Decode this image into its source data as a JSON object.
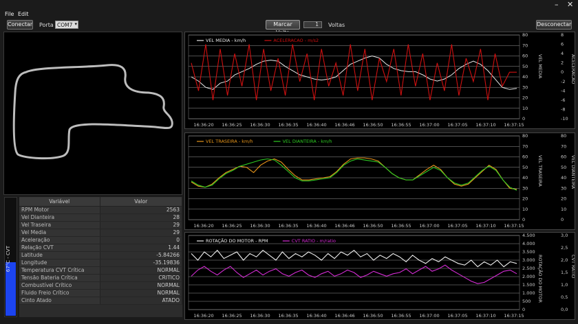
{
  "window": {
    "minimize_icon": "minimize-icon",
    "close_icon": "close-icon"
  },
  "menu": {
    "file": "File",
    "edit": "Edit"
  },
  "toolbar": {
    "connect_label": "Conectar",
    "port_label": "Porta",
    "port_value": "COM7",
    "lap_button_label": "Marcar Volta",
    "lap_count": "1",
    "laps_label": "Voltas",
    "disconnect_label": "Desconectar"
  },
  "table": {
    "headers": [
      "Variável",
      "Valor"
    ],
    "rows": [
      {
        "name": "RPM Motor",
        "value": "2563"
      },
      {
        "name": "Vel Dianteira",
        "value": "28"
      },
      {
        "name": "Vel Traseira",
        "value": "29"
      },
      {
        "name": "Vel Media",
        "value": "29"
      },
      {
        "name": "Aceleração",
        "value": "0"
      },
      {
        "name": "Relação CVT",
        "value": "1.44"
      },
      {
        "name": "Latitude",
        "value": "-5.84266"
      },
      {
        "name": "Longitude",
        "value": "-35.19836"
      },
      {
        "name": "Temperatura CVT Crítica",
        "value": "NORMAL"
      },
      {
        "name": "Tensão Bateria Crítica",
        "value": "CRITICO"
      },
      {
        "name": "Combustível Crítico",
        "value": "NORMAL"
      },
      {
        "name": "Fluido Freio Crítico",
        "value": "NORMAL"
      },
      {
        "name": "Cinto Atado",
        "value": "ATADO"
      }
    ]
  },
  "gauge": {
    "label": "67°C - CVT",
    "level": 0.45,
    "color": "#1c44f0"
  },
  "chart_data": [
    {
      "type": "line",
      "series": [
        {
          "name": "VEL MEDIA - km/h",
          "color": "#e8e8e8",
          "axis": "left"
        },
        {
          "name": "ACELERACAO - m/s2",
          "color": "#d01010",
          "axis": "right"
        }
      ],
      "x_ticks": [
        "16:36:20",
        "16:36:25",
        "16:36:30",
        "16:36:35",
        "16:36:40",
        "16:36:46",
        "16:36:50",
        "16:36:55",
        "16:37:00",
        "16:37:05",
        "16:37:10",
        "16:37:15"
      ],
      "ylabel_left": "VEL MEDIA",
      "ylabel_right": "ACELERACAO",
      "left_ticks": [
        "80",
        "70",
        "60",
        "50",
        "40",
        "30",
        "20",
        "10",
        "0"
      ],
      "right_ticks": [
        "8",
        "6",
        "4",
        "2",
        "0",
        "-2",
        "-4",
        "-6",
        "-8",
        "-10"
      ],
      "ylim_left": [
        0,
        80
      ],
      "ylim_right": [
        -10,
        8
      ],
      "grid": true,
      "vel_media_values": [
        40,
        36,
        30,
        28,
        34,
        36,
        42,
        45,
        48,
        52,
        55,
        56,
        55,
        50,
        46,
        42,
        40,
        38,
        37,
        38,
        40,
        46,
        52,
        55,
        58,
        60,
        58,
        52,
        48,
        46,
        45,
        45,
        42,
        38,
        36,
        38,
        42,
        48,
        52,
        55,
        52,
        46,
        38,
        30,
        28,
        29
      ],
      "aceleracao_values": [
        2,
        -4,
        6,
        -6,
        5,
        -5,
        4,
        -3,
        6,
        -6,
        5,
        -4,
        3,
        -5,
        6,
        -2,
        4,
        -6,
        5,
        -3,
        2,
        -5,
        6,
        -4,
        5,
        -6,
        3,
        -2,
        5,
        -5,
        6,
        -3,
        4,
        -6,
        2,
        -4,
        6,
        -5,
        3,
        -2,
        5,
        -6,
        4,
        -3,
        0,
        0
      ]
    },
    {
      "type": "line",
      "series": [
        {
          "name": "VEL TRASEIRA - km/h",
          "color": "#e8961a",
          "axis": "left"
        },
        {
          "name": "VEL DIANTEIRA - km/h",
          "color": "#2ecc23",
          "axis": "right"
        }
      ],
      "x_ticks": [
        "16:36:20",
        "16:36:25",
        "16:36:30",
        "16:36:35",
        "16:36:40",
        "16:36:46",
        "16:36:50",
        "16:36:55",
        "16:37:00",
        "16:37:05",
        "16:37:10",
        "16:37:15"
      ],
      "ylabel_left": "VEL TRASEIRA",
      "ylabel_right": "VEL DIANTEIRA",
      "left_ticks": [
        "80",
        "70",
        "60",
        "50",
        "40",
        "30",
        "20",
        "10",
        "0"
      ],
      "right_ticks": [
        "80",
        "70",
        "60",
        "50",
        "40",
        "30",
        "20",
        "10",
        "0"
      ],
      "ylim": [
        0,
        80
      ],
      "grid": true,
      "traseira_values": [
        36,
        32,
        31,
        34,
        40,
        45,
        48,
        51,
        50,
        45,
        52,
        56,
        58,
        55,
        48,
        42,
        38,
        38,
        39,
        40,
        41,
        46,
        53,
        58,
        59,
        59,
        58,
        56,
        50,
        44,
        40,
        38,
        38,
        43,
        48,
        52,
        48,
        40,
        34,
        32,
        34,
        40,
        46,
        52,
        48,
        38,
        30,
        29
      ],
      "dianteira_values": [
        37,
        33,
        31,
        33,
        39,
        44,
        47,
        51,
        53,
        55,
        57,
        58,
        57,
        52,
        46,
        40,
        37,
        37,
        38,
        39,
        40,
        45,
        52,
        56,
        58,
        57,
        56,
        55,
        50,
        44,
        40,
        38,
        38,
        42,
        46,
        50,
        47,
        40,
        35,
        33,
        35,
        41,
        47,
        51,
        47,
        38,
        31,
        28
      ]
    },
    {
      "type": "line",
      "series": [
        {
          "name": "ROTAÇÃO DO MOTOR - RPM",
          "color": "#f0f0f0",
          "axis": "left"
        },
        {
          "name": "CVT RATIO - m/ratio",
          "color": "#d62cd6",
          "axis": "right"
        }
      ],
      "x_ticks": [
        "16:36:20",
        "16:36:25",
        "16:36:30",
        "16:36:35",
        "16:36:40",
        "16:36:46",
        "16:36:50",
        "16:36:55",
        "16:37:00",
        "16:37:05",
        "16:37:10",
        "16:37:15"
      ],
      "ylabel_left": "ROTAÇÃO DO MOTOR",
      "ylabel_right": "CVT RATIO",
      "left_ticks": [
        "4.500",
        "4.000",
        "3.500",
        "3.000",
        "2.500",
        "2.000",
        "1.500",
        "1.000",
        "500",
        "0"
      ],
      "right_ticks": [
        "3,0",
        "2,5",
        "2,0",
        "1,5",
        "1,0",
        "0,5",
        "0,0"
      ],
      "ylim_left": [
        0,
        4500
      ],
      "ylim_right": [
        0,
        3
      ],
      "grid": true,
      "rpm_values": [
        3400,
        3000,
        3500,
        3200,
        3600,
        3100,
        3300,
        3500,
        3000,
        3400,
        3200,
        3600,
        3300,
        3000,
        3500,
        3100,
        3400,
        3200,
        3500,
        3300,
        3000,
        3400,
        3100,
        3500,
        3300,
        3600,
        3200,
        3400,
        3000,
        3300,
        3100,
        3400,
        3200,
        2900,
        3300,
        3000,
        2800,
        3100,
        2900,
        3200,
        3000,
        2800,
        2700,
        3000,
        2600,
        2900,
        2700,
        3000,
        2600,
        2900,
        2800
      ],
      "cvt_values": [
        1.35,
        1.6,
        1.75,
        1.55,
        1.4,
        1.6,
        1.75,
        1.5,
        1.3,
        1.45,
        1.6,
        1.4,
        1.55,
        1.65,
        1.45,
        1.35,
        1.5,
        1.6,
        1.4,
        1.3,
        1.45,
        1.55,
        1.35,
        1.45,
        1.6,
        1.5,
        1.3,
        1.4,
        1.55,
        1.45,
        1.35,
        1.45,
        1.5,
        1.65,
        1.45,
        1.6,
        1.75,
        1.55,
        1.65,
        1.8,
        1.6,
        1.45,
        1.3,
        1.15,
        1.05,
        1.1,
        1.25,
        1.4,
        1.55,
        1.6,
        1.45
      ]
    }
  ]
}
